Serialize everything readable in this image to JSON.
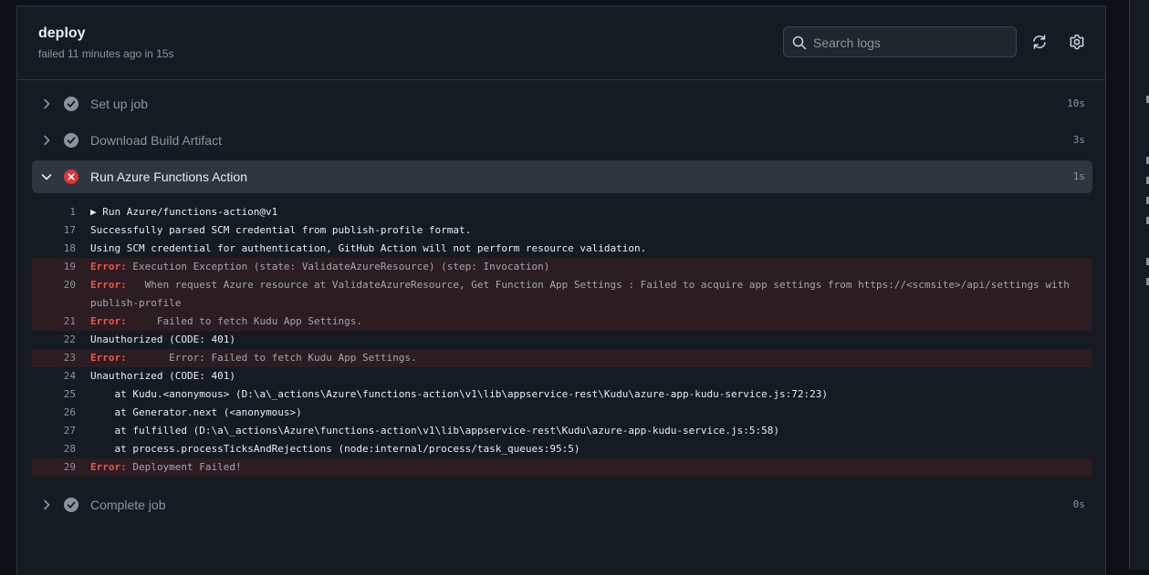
{
  "job": {
    "title": "deploy",
    "meta": "failed 11 minutes ago in 15s"
  },
  "search": {
    "placeholder": "Search logs"
  },
  "steps": [
    {
      "label": "Set up job",
      "duration": "10s",
      "status": "success"
    },
    {
      "label": "Download Build Artifact",
      "duration": "3s",
      "status": "success"
    },
    {
      "label": "Run Azure Functions Action",
      "duration": "1s",
      "status": "failure"
    },
    {
      "label": "Complete job",
      "duration": "0s",
      "status": "success"
    }
  ],
  "logs": [
    {
      "n": "1",
      "err": false,
      "kw": "",
      "text": "▶ Run Azure/functions-action@v1"
    },
    {
      "n": "17",
      "err": false,
      "kw": "",
      "text": "Successfully parsed SCM credential from publish-profile format."
    },
    {
      "n": "18",
      "err": false,
      "kw": "",
      "text": "Using SCM credential for authentication, GitHub Action will not perform resource validation."
    },
    {
      "n": "19",
      "err": true,
      "kw": "Error:",
      "text": " Execution Exception (state: ValidateAzureResource) (step: Invocation)"
    },
    {
      "n": "20",
      "err": true,
      "kw": "Error:",
      "text": "   When request Azure resource at ValidateAzureResource, Get Function App Settings : Failed to acquire app settings from https://<scmsite>/api/settings with publish-profile"
    },
    {
      "n": "21",
      "err": true,
      "kw": "Error:",
      "text": "     Failed to fetch Kudu App Settings."
    },
    {
      "n": "22",
      "err": false,
      "kw": "",
      "text": "Unauthorized (CODE: 401)"
    },
    {
      "n": "23",
      "err": true,
      "kw": "Error:",
      "text": "       Error: Failed to fetch Kudu App Settings."
    },
    {
      "n": "24",
      "err": false,
      "kw": "",
      "text": "Unauthorized (CODE: 401)"
    },
    {
      "n": "25",
      "err": false,
      "kw": "",
      "text": "    at Kudu.<anonymous> (D:\\a\\_actions\\Azure\\functions-action\\v1\\lib\\appservice-rest\\Kudu\\azure-app-kudu-service.js:72:23)"
    },
    {
      "n": "26",
      "err": false,
      "kw": "",
      "text": "    at Generator.next (<anonymous>)"
    },
    {
      "n": "27",
      "err": false,
      "kw": "",
      "text": "    at fulfilled (D:\\a\\_actions\\Azure\\functions-action\\v1\\lib\\appservice-rest\\Kudu\\azure-app-kudu-service.js:5:58)"
    },
    {
      "n": "28",
      "err": false,
      "kw": "",
      "text": "    at process.processTicksAndRejections (node:internal/process/task_queues:95:5)"
    },
    {
      "n": "29",
      "err": true,
      "kw": "Error:",
      "text": " Deployment Failed!"
    }
  ],
  "colors": {
    "success": "#8b949e",
    "failure": "#da3633",
    "error_text": "#f85149",
    "error_bg": "#2b1d22"
  },
  "icons": {
    "search": "search-icon",
    "refresh": "refresh-icon",
    "settings": "gear-icon",
    "chevron_right": "chevron-right-icon",
    "chevron_down": "chevron-down-icon"
  }
}
